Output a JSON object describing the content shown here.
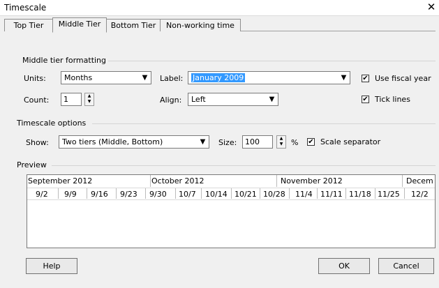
{
  "window": {
    "title": "Timescale",
    "close_glyph": "✕"
  },
  "tabs": [
    {
      "label": "Top Tier"
    },
    {
      "label": "Middle Tier",
      "active": true
    },
    {
      "label": "Bottom Tier"
    },
    {
      "label": "Non-working time"
    }
  ],
  "middle_tier": {
    "group_label": "Middle tier formatting",
    "units_label": "Units:",
    "units_value": "Months",
    "label_label": "Label:",
    "label_value": "January 2009",
    "use_fiscal_year": {
      "label": "Use fiscal year",
      "checked": true
    },
    "count_label": "Count:",
    "count_value": "1",
    "align_label": "Align:",
    "align_value": "Left",
    "tick_lines": {
      "label": "Tick lines",
      "checked": true
    }
  },
  "timescale_options": {
    "group_label": "Timescale options",
    "show_label": "Show:",
    "show_value": "Two tiers (Middle, Bottom)",
    "size_label": "Size:",
    "size_value": "100",
    "percent": "%",
    "scale_separator": {
      "label": "Scale separator",
      "checked": true
    }
  },
  "preview": {
    "group_label": "Preview",
    "months": [
      "September 2012",
      "October 2012",
      "November 2012",
      "Decem"
    ],
    "weeks": [
      "9/2",
      "9/9",
      "9/16",
      "9/23",
      "9/30",
      "10/7",
      "10/14",
      "10/21",
      "10/28",
      "11/4",
      "11/11",
      "11/18",
      "11/25",
      "12/2"
    ]
  },
  "buttons": {
    "help": "Help",
    "ok": "OK",
    "cancel": "Cancel"
  },
  "colors": {
    "selection": "#3399ff",
    "dialog_bg": "#f0f0f0"
  }
}
